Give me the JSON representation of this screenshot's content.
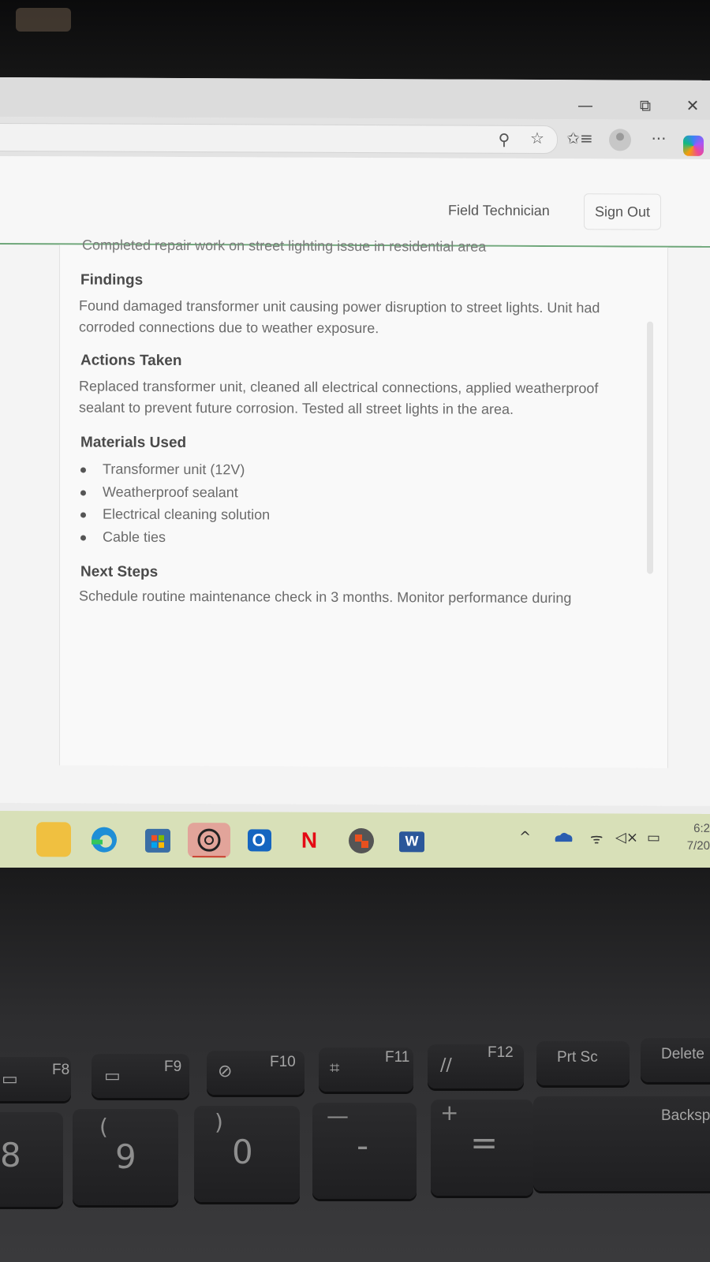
{
  "browser": {
    "window_controls": {
      "minimize": "—",
      "restore": "⧉",
      "close": "✕"
    },
    "toolbar_icons": [
      "location-icon",
      "star-icon",
      "favorites-icon",
      "profile-avatar",
      "more-icon",
      "copilot-icon"
    ],
    "toolbar_glyphs": {
      "location": "⚲",
      "star": "☆",
      "favorites": "✩≡",
      "more": "···"
    }
  },
  "header": {
    "role_label": "Field Technician",
    "sign_out_label": "Sign Out"
  },
  "report": {
    "summary_cut": "Completed repair work on street lighting issue in residential area",
    "findings": {
      "title": "Findings",
      "body": "Found damaged transformer unit causing power disruption to street lights. Unit had corroded connections due to weather exposure."
    },
    "actions": {
      "title": "Actions Taken",
      "body": "Replaced transformer unit, cleaned all electrical connections, applied weatherproof sealant to prevent future corrosion. Tested all street lights in the area."
    },
    "materials": {
      "title": "Materials Used",
      "items": [
        "Transformer unit (12V)",
        "Weatherproof sealant",
        "Electrical cleaning solution",
        "Cable ties"
      ]
    },
    "next_steps": {
      "title": "Next Steps",
      "body": "Schedule routine maintenance check in 3 months. Monitor performance during"
    }
  },
  "taskbar": {
    "apps": [
      "file-explorer",
      "edge",
      "microsoft-store",
      "chatgpt",
      "outlook",
      "netflix",
      "office",
      "word"
    ],
    "app_glyphs": {
      "outlook": "O",
      "netflix": "N",
      "word": "W"
    },
    "tray_glyphs": {
      "chevron": "^",
      "wifi": "ᯤ",
      "volume": "◁×",
      "battery": "▭"
    },
    "clock_time": "6:2",
    "clock_date": "7/20",
    "accent": "#d8e0b8"
  },
  "keyboard": {
    "fn_keys": [
      "F8",
      "F9",
      "F10",
      "F11",
      "F12",
      "Prt Sc",
      "Delete"
    ],
    "num_keys": [
      "8",
      "9",
      "0",
      "-",
      "=",
      "Backsp"
    ],
    "shift_symbols": {
      "9": "(",
      "0": ")",
      "-": "—",
      "=": "+"
    }
  }
}
